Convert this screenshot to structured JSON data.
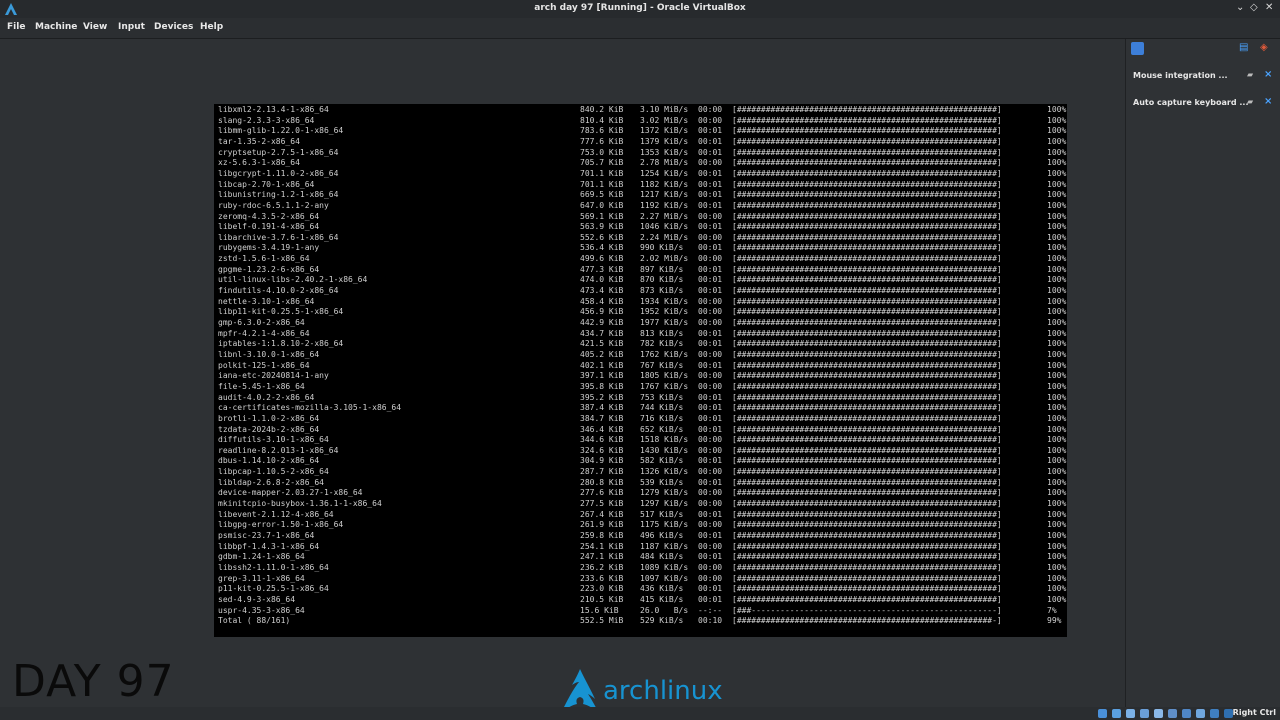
{
  "window": {
    "title": "arch day 97 [Running] - Oracle VirtualBox"
  },
  "menu": [
    "File",
    "Machine",
    "View",
    "Input",
    "Devices",
    "Help"
  ],
  "notifications": [
    {
      "label": "Mouse integration ..."
    },
    {
      "label": "Auto capture keyboard ..."
    }
  ],
  "status": {
    "host_key": "Right Ctrl"
  },
  "overlay": {
    "day_text": "DAY 97",
    "logo_text_a": "arch",
    "logo_text_b": "linux"
  },
  "colors": {
    "accent": "#1793d1",
    "console_bg": "#000000",
    "panel_bg": "#2f3235"
  },
  "console": {
    "rows": [
      {
        "name": "libxml2-2.13.4-1-x86_64",
        "size": "840.2 KiB",
        "rate": "3.10 MiB/s",
        "time": "00:00",
        "bar": "[######################################################]",
        "pct": "100%"
      },
      {
        "name": "slang-2.3.3-3-x86_64",
        "size": "810.4 KiB",
        "rate": "3.02 MiB/s",
        "time": "00:00",
        "bar": "[######################################################]",
        "pct": "100%"
      },
      {
        "name": "libmm-glib-1.22.0-1-x86_64",
        "size": "783.6 KiB",
        "rate": "1372 KiB/s",
        "time": "00:01",
        "bar": "[######################################################]",
        "pct": "100%"
      },
      {
        "name": "tar-1.35-2-x86_64",
        "size": "777.6 KiB",
        "rate": "1379 KiB/s",
        "time": "00:01",
        "bar": "[######################################################]",
        "pct": "100%"
      },
      {
        "name": "cryptsetup-2.7.5-1-x86_64",
        "size": "753.0 KiB",
        "rate": "1353 KiB/s",
        "time": "00:01",
        "bar": "[######################################################]",
        "pct": "100%"
      },
      {
        "name": "xz-5.6.3-1-x86_64",
        "size": "705.7 KiB",
        "rate": "2.78 MiB/s",
        "time": "00:00",
        "bar": "[######################################################]",
        "pct": "100%"
      },
      {
        "name": "libgcrypt-1.11.0-2-x86_64",
        "size": "701.1 KiB",
        "rate": "1254 KiB/s",
        "time": "00:01",
        "bar": "[######################################################]",
        "pct": "100%"
      },
      {
        "name": "libcap-2.70-1-x86_64",
        "size": "701.1 KiB",
        "rate": "1182 KiB/s",
        "time": "00:01",
        "bar": "[######################################################]",
        "pct": "100%"
      },
      {
        "name": "libunistring-1.2-1-x86_64",
        "size": "669.5 KiB",
        "rate": "1217 KiB/s",
        "time": "00:01",
        "bar": "[######################################################]",
        "pct": "100%"
      },
      {
        "name": "ruby-rdoc-6.5.1.1-2-any",
        "size": "647.0 KiB",
        "rate": "1192 KiB/s",
        "time": "00:01",
        "bar": "[######################################################]",
        "pct": "100%"
      },
      {
        "name": "zeromq-4.3.5-2-x86_64",
        "size": "569.1 KiB",
        "rate": "2.27 MiB/s",
        "time": "00:00",
        "bar": "[######################################################]",
        "pct": "100%"
      },
      {
        "name": "libelf-0.191-4-x86_64",
        "size": "563.9 KiB",
        "rate": "1046 KiB/s",
        "time": "00:01",
        "bar": "[######################################################]",
        "pct": "100%"
      },
      {
        "name": "libarchive-3.7.6-1-x86_64",
        "size": "552.6 KiB",
        "rate": "2.24 MiB/s",
        "time": "00:00",
        "bar": "[######################################################]",
        "pct": "100%"
      },
      {
        "name": "rubygems-3.4.19-1-any",
        "size": "536.4 KiB",
        "rate": "990 KiB/s",
        "time": "00:01",
        "bar": "[######################################################]",
        "pct": "100%"
      },
      {
        "name": "zstd-1.5.6-1-x86_64",
        "size": "499.6 KiB",
        "rate": "2.02 MiB/s",
        "time": "00:00",
        "bar": "[######################################################]",
        "pct": "100%"
      },
      {
        "name": "gpgme-1.23.2-6-x86_64",
        "size": "477.3 KiB",
        "rate": "897 KiB/s",
        "time": "00:01",
        "bar": "[######################################################]",
        "pct": "100%"
      },
      {
        "name": "util-linux-libs-2.40.2-1-x86_64",
        "size": "474.0 KiB",
        "rate": "870 KiB/s",
        "time": "00:01",
        "bar": "[######################################################]",
        "pct": "100%"
      },
      {
        "name": "findutils-4.10.0-2-x86_64",
        "size": "473.4 KiB",
        "rate": "873 KiB/s",
        "time": "00:01",
        "bar": "[######################################################]",
        "pct": "100%"
      },
      {
        "name": "nettle-3.10-1-x86_64",
        "size": "458.4 KiB",
        "rate": "1934 KiB/s",
        "time": "00:00",
        "bar": "[######################################################]",
        "pct": "100%"
      },
      {
        "name": "libp11-kit-0.25.5-1-x86_64",
        "size": "456.9 KiB",
        "rate": "1952 KiB/s",
        "time": "00:00",
        "bar": "[######################################################]",
        "pct": "100%"
      },
      {
        "name": "gmp-6.3.0-2-x86_64",
        "size": "442.9 KiB",
        "rate": "1977 KiB/s",
        "time": "00:00",
        "bar": "[######################################################]",
        "pct": "100%"
      },
      {
        "name": "mpfr-4.2.1-4-x86_64",
        "size": "434.7 KiB",
        "rate": "813 KiB/s",
        "time": "00:01",
        "bar": "[######################################################]",
        "pct": "100%"
      },
      {
        "name": "iptables-1:1.8.10-2-x86_64",
        "size": "421.5 KiB",
        "rate": "782 KiB/s",
        "time": "00:01",
        "bar": "[######################################################]",
        "pct": "100%"
      },
      {
        "name": "libnl-3.10.0-1-x86_64",
        "size": "405.2 KiB",
        "rate": "1762 KiB/s",
        "time": "00:00",
        "bar": "[######################################################]",
        "pct": "100%"
      },
      {
        "name": "polkit-125-1-x86_64",
        "size": "402.1 KiB",
        "rate": "767 KiB/s",
        "time": "00:01",
        "bar": "[######################################################]",
        "pct": "100%"
      },
      {
        "name": "iana-etc-20240814-1-any",
        "size": "397.1 KiB",
        "rate": "1805 KiB/s",
        "time": "00:00",
        "bar": "[######################################################]",
        "pct": "100%"
      },
      {
        "name": "file-5.45-1-x86_64",
        "size": "395.8 KiB",
        "rate": "1767 KiB/s",
        "time": "00:00",
        "bar": "[######################################################]",
        "pct": "100%"
      },
      {
        "name": "audit-4.0.2-2-x86_64",
        "size": "395.2 KiB",
        "rate": "753 KiB/s",
        "time": "00:01",
        "bar": "[######################################################]",
        "pct": "100%"
      },
      {
        "name": "ca-certificates-mozilla-3.105-1-x86_64",
        "size": "387.4 KiB",
        "rate": "744 KiB/s",
        "time": "00:01",
        "bar": "[######################################################]",
        "pct": "100%"
      },
      {
        "name": "brotli-1.1.0-2-x86_64",
        "size": "384.7 KiB",
        "rate": "716 KiB/s",
        "time": "00:01",
        "bar": "[######################################################]",
        "pct": "100%"
      },
      {
        "name": "tzdata-2024b-2-x86_64",
        "size": "346.4 KiB",
        "rate": "652 KiB/s",
        "time": "00:01",
        "bar": "[######################################################]",
        "pct": "100%"
      },
      {
        "name": "diffutils-3.10-1-x86_64",
        "size": "344.6 KiB",
        "rate": "1518 KiB/s",
        "time": "00:00",
        "bar": "[######################################################]",
        "pct": "100%"
      },
      {
        "name": "readline-8.2.013-1-x86_64",
        "size": "324.6 KiB",
        "rate": "1430 KiB/s",
        "time": "00:00",
        "bar": "[######################################################]",
        "pct": "100%"
      },
      {
        "name": "dbus-1.14.10-2-x86_64",
        "size": "304.9 KiB",
        "rate": "582 KiB/s",
        "time": "00:01",
        "bar": "[######################################################]",
        "pct": "100%"
      },
      {
        "name": "libpcap-1.10.5-2-x86_64",
        "size": "287.7 KiB",
        "rate": "1326 KiB/s",
        "time": "00:00",
        "bar": "[######################################################]",
        "pct": "100%"
      },
      {
        "name": "libldap-2.6.8-2-x86_64",
        "size": "280.8 KiB",
        "rate": "539 KiB/s",
        "time": "00:01",
        "bar": "[######################################################]",
        "pct": "100%"
      },
      {
        "name": "device-mapper-2.03.27-1-x86_64",
        "size": "277.6 KiB",
        "rate": "1279 KiB/s",
        "time": "00:00",
        "bar": "[######################################################]",
        "pct": "100%"
      },
      {
        "name": "mkinitcpio-busybox-1.36.1-1-x86_64",
        "size": "277.5 KiB",
        "rate": "1297 KiB/s",
        "time": "00:00",
        "bar": "[######################################################]",
        "pct": "100%"
      },
      {
        "name": "libevent-2.1.12-4-x86_64",
        "size": "267.4 KiB",
        "rate": "517 KiB/s",
        "time": "00:01",
        "bar": "[######################################################]",
        "pct": "100%"
      },
      {
        "name": "libgpg-error-1.50-1-x86_64",
        "size": "261.9 KiB",
        "rate": "1175 KiB/s",
        "time": "00:00",
        "bar": "[######################################################]",
        "pct": "100%"
      },
      {
        "name": "psmisc-23.7-1-x86_64",
        "size": "259.8 KiB",
        "rate": "496 KiB/s",
        "time": "00:01",
        "bar": "[######################################################]",
        "pct": "100%"
      },
      {
        "name": "libbpf-1.4.3-1-x86_64",
        "size": "254.1 KiB",
        "rate": "1187 KiB/s",
        "time": "00:00",
        "bar": "[######################################################]",
        "pct": "100%"
      },
      {
        "name": "gdbm-1.24-1-x86_64",
        "size": "247.1 KiB",
        "rate": "484 KiB/s",
        "time": "00:01",
        "bar": "[######################################################]",
        "pct": "100%"
      },
      {
        "name": "libssh2-1.11.0-1-x86_64",
        "size": "236.2 KiB",
        "rate": "1089 KiB/s",
        "time": "00:00",
        "bar": "[######################################################]",
        "pct": "100%"
      },
      {
        "name": "grep-3.11-1-x86_64",
        "size": "233.6 KiB",
        "rate": "1097 KiB/s",
        "time": "00:00",
        "bar": "[######################################################]",
        "pct": "100%"
      },
      {
        "name": "p11-kit-0.25.5-1-x86_64",
        "size": "223.0 KiB",
        "rate": "436 KiB/s",
        "time": "00:01",
        "bar": "[######################################################]",
        "pct": "100%"
      },
      {
        "name": "sed-4.9-3-x86_64",
        "size": "210.5 KiB",
        "rate": "415 KiB/s",
        "time": "00:01",
        "bar": "[######################################################]",
        "pct": "100%"
      },
      {
        "name": "uspr-4.35-3-x86_64",
        "size": "15.6 KiB",
        "rate": "26.0   B/s",
        "time": "--:--",
        "bar": "[###---------------------------------------------------]",
        "pct": "7%"
      },
      {
        "name": "Total ( 88/161)",
        "size": "552.5 MiB",
        "rate": "529 KiB/s",
        "time": "00:10",
        "bar": "[#####################################################-]",
        "pct": "99%"
      }
    ]
  }
}
